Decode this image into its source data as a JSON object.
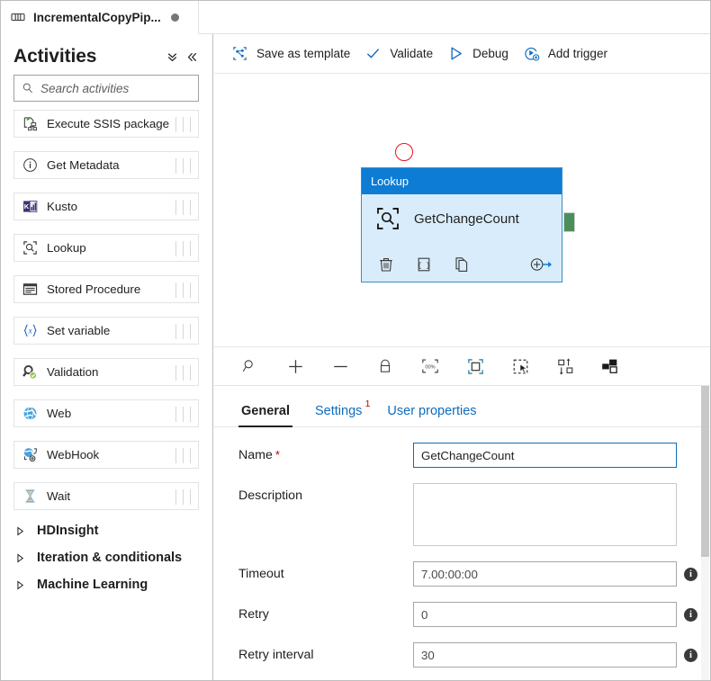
{
  "pipeline_tab": {
    "title": "IncrementalCopyPip...",
    "icon": "pipeline-icon",
    "dirty_indicator": "unsaved-changes-dot"
  },
  "sidebar": {
    "title": "Activities",
    "collapse_all_icon": "double-chevron-down-icon",
    "collapse_panel_icon": "double-chevron-left-icon",
    "search": {
      "placeholder": "Search activities",
      "value": "",
      "icon": "search-icon"
    },
    "items": [
      {
        "label": "Execute SSIS package",
        "icon": "execute-ssis-package-icon"
      },
      {
        "label": "Get Metadata",
        "icon": "get-metadata-icon"
      },
      {
        "label": "Kusto",
        "icon": "kusto-icon"
      },
      {
        "label": "Lookup",
        "icon": "lookup-icon"
      },
      {
        "label": "Stored Procedure",
        "icon": "stored-procedure-icon"
      },
      {
        "label": "Set variable",
        "icon": "set-variable-icon"
      },
      {
        "label": "Validation",
        "icon": "validation-icon"
      },
      {
        "label": "Web",
        "icon": "web-icon"
      },
      {
        "label": "WebHook",
        "icon": "webhook-icon"
      },
      {
        "label": "Wait",
        "icon": "wait-icon"
      }
    ],
    "groups": [
      {
        "label": "HDInsight",
        "icon": "chevron-right-icon",
        "expanded": false
      },
      {
        "label": "Iteration & conditionals",
        "icon": "chevron-right-icon",
        "expanded": false
      },
      {
        "label": "Machine Learning",
        "icon": "chevron-right-icon",
        "expanded": false
      }
    ]
  },
  "canvas_toolbar": {
    "buttons": [
      {
        "label": "Save as template",
        "icon": "save-as-template-icon"
      },
      {
        "label": "Validate",
        "icon": "checkmark-icon"
      },
      {
        "label": "Debug",
        "icon": "play-triangle-icon"
      },
      {
        "label": "Add trigger",
        "icon": "add-trigger-icon"
      }
    ]
  },
  "canvas": {
    "node": {
      "type_label": "Lookup",
      "name": "GetChangeCount",
      "icon": "lookup-activity-icon",
      "header_color": "#0c7cd5",
      "body_color": "#d9ecfb",
      "border_color": "#3a8dbe",
      "actions": [
        {
          "icon": "delete-trash-icon",
          "name": "delete-activity"
        },
        {
          "icon": "code-braces-icon",
          "name": "view-code"
        },
        {
          "icon": "copy-duplicate-icon",
          "name": "clone-activity"
        },
        {
          "icon": "add-output-arrow-icon",
          "name": "add-output-connection"
        }
      ],
      "error_indicator": {
        "icon": "error-circle-icon",
        "color": "#e81123"
      },
      "success_connector": {
        "icon": "success-connector-handle",
        "color": "#4a8f5a"
      }
    }
  },
  "zoom_toolbar": {
    "buttons": [
      {
        "icon": "zoom-search-icon",
        "name": "zoom-tool"
      },
      {
        "icon": "zoom-in-plus-icon",
        "name": "zoom-in"
      },
      {
        "icon": "zoom-out-minus-icon",
        "name": "zoom-out"
      },
      {
        "icon": "lock-icon",
        "name": "lock-canvas"
      },
      {
        "icon": "zoom-100-percent-icon",
        "name": "zoom-to-100",
        "text": "00%"
      },
      {
        "icon": "zoom-to-fit-icon",
        "name": "zoom-to-fit"
      },
      {
        "icon": "marquee-select-icon",
        "name": "marquee-select"
      },
      {
        "icon": "auto-align-icon",
        "name": "auto-align"
      },
      {
        "icon": "toggle-minimap-icon",
        "name": "toggle-minimap"
      }
    ]
  },
  "properties": {
    "tabs": [
      {
        "label": "General",
        "active": true,
        "badge": ""
      },
      {
        "label": "Settings",
        "active": false,
        "badge": "1"
      },
      {
        "label": "User properties",
        "active": false,
        "badge": ""
      }
    ],
    "fields": [
      {
        "label": "Name",
        "required": true,
        "type": "text",
        "value": "GetChangeCount",
        "placeholder": "",
        "focused": true,
        "has_info": false
      },
      {
        "label": "Description",
        "required": false,
        "type": "textarea",
        "value": "",
        "placeholder": "",
        "focused": false,
        "has_info": false
      },
      {
        "label": "Timeout",
        "required": false,
        "type": "text",
        "value": "7.00:00:00",
        "placeholder": "",
        "focused": false,
        "has_info": true
      },
      {
        "label": "Retry",
        "required": false,
        "type": "text",
        "value": "0",
        "placeholder": "",
        "focused": false,
        "has_info": true
      },
      {
        "label": "Retry interval",
        "required": false,
        "type": "text",
        "value": "30",
        "placeholder": "",
        "focused": false,
        "has_info": true
      }
    ],
    "info_icon": "info-circle-icon"
  },
  "colors": {
    "accent": "#0f6cbd",
    "node_header": "#0c7cd5",
    "node_body": "#d9ecfb",
    "error_red": "#e81123",
    "success_green": "#4a8f5a",
    "required_red": "#c00000"
  }
}
